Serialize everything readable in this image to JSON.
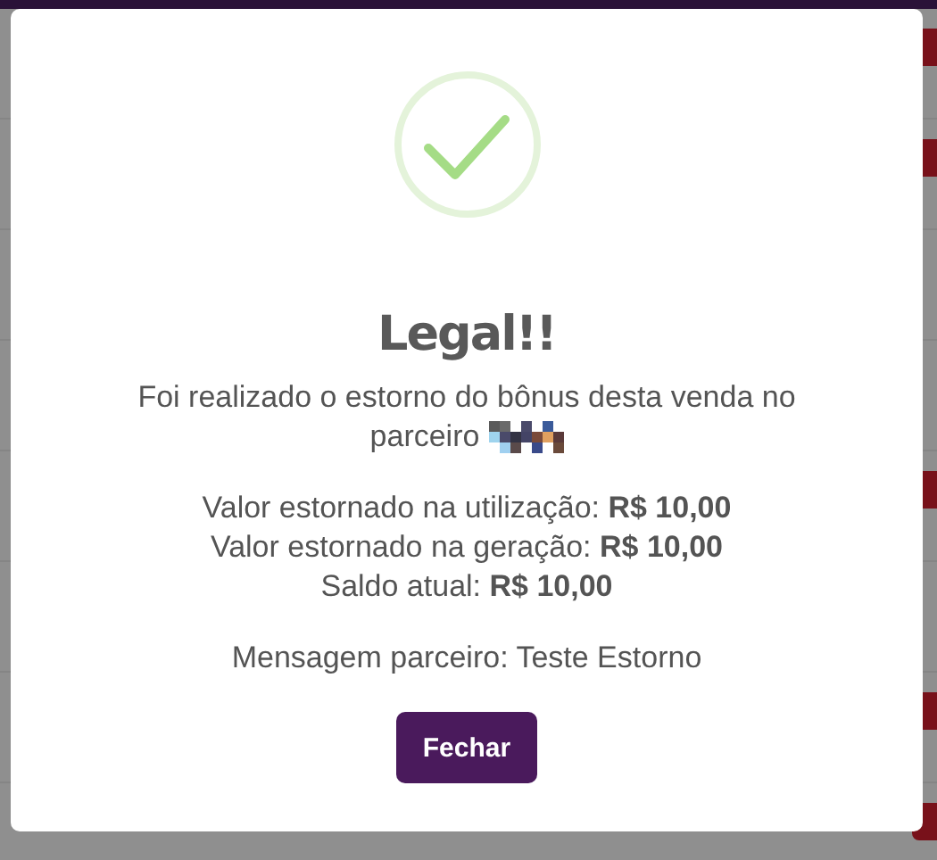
{
  "background": {
    "rows": [
      {
        "badge": true
      },
      {
        "badge": true
      },
      {
        "badge": false
      },
      {
        "badge": false
      },
      {
        "badge": true
      },
      {
        "badge": false
      },
      {
        "badge": true
      },
      {
        "badge": true
      }
    ]
  },
  "dialog": {
    "title": "Legal!!",
    "message_lines": [
      "Foi realizado o estorno do bônus desta venda no",
      "parceiro"
    ],
    "details": [
      "Valor estornado na utilização: **R$ 10,00**",
      "Valor estornado na geração: **R$ 10,00**",
      "Saldo atual: **R$ 10,00**"
    ],
    "partner_message": "Mensagem parceiro: Teste Estorno",
    "button": "Fechar"
  }
}
